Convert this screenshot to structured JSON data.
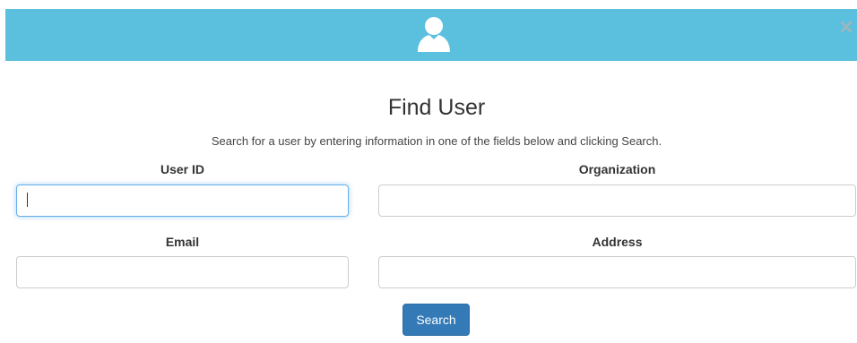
{
  "header": {
    "icon": "user-icon",
    "close_label": "×",
    "color": "#5bc0de"
  },
  "title": "Find User",
  "subtitle": "Search for a user by entering information in one of the fields below and clicking Search.",
  "fields": {
    "user_id": {
      "label": "User ID",
      "value": "",
      "placeholder": ""
    },
    "organization": {
      "label": "Organization",
      "value": "",
      "placeholder": ""
    },
    "email": {
      "label": "Email",
      "value": "",
      "placeholder": ""
    },
    "address": {
      "label": "Address",
      "value": "",
      "placeholder": ""
    }
  },
  "search_button": {
    "label": "Search",
    "color": "#337ab7"
  }
}
